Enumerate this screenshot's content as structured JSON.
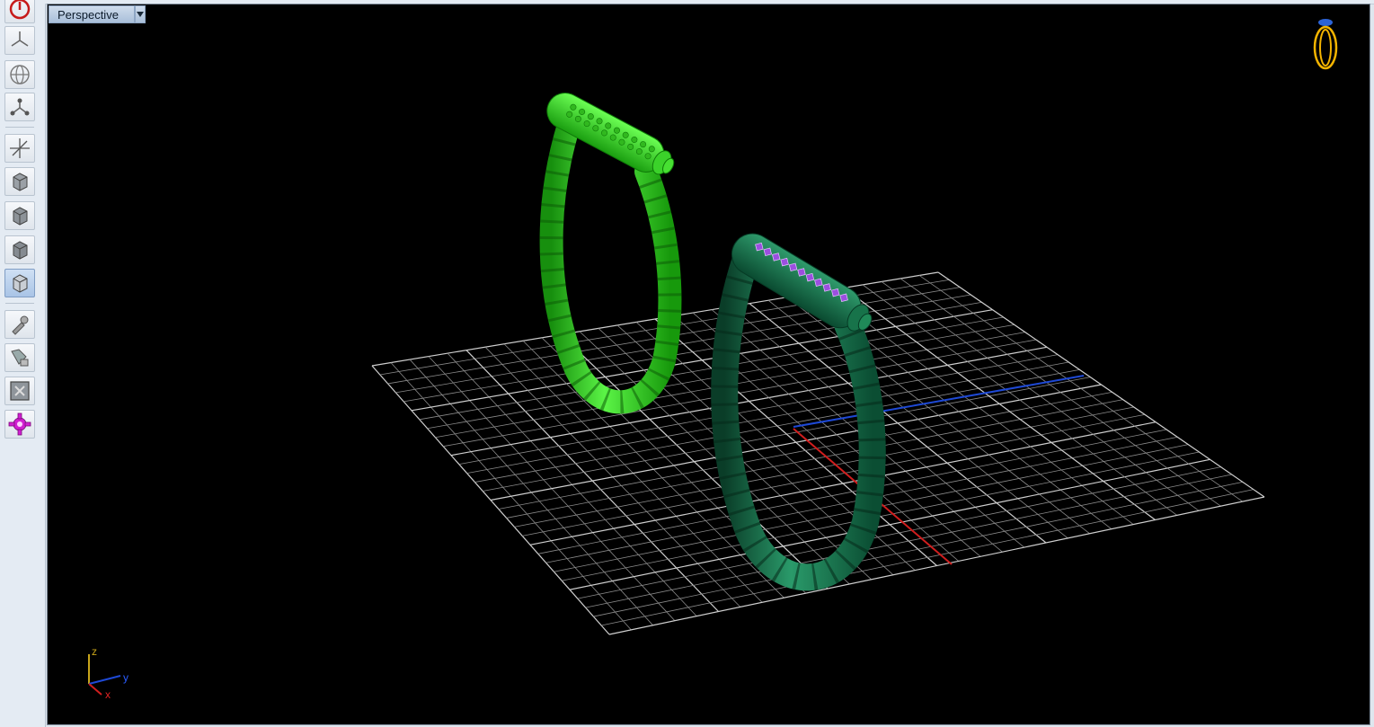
{
  "viewport": {
    "label": "Perspective",
    "dropdown_icon": "chevron-down-icon",
    "background": "#000000"
  },
  "toolbar": {
    "buttons": [
      {
        "name": "power-icon",
        "active": false
      },
      {
        "name": "top-view-icon",
        "active": false
      },
      {
        "name": "globe-icon",
        "active": false
      },
      {
        "name": "nodes-icon",
        "active": false
      },
      {
        "name": "axis-move-icon",
        "active": false
      },
      {
        "name": "cube-front-icon",
        "active": false
      },
      {
        "name": "cube-side-icon",
        "active": false
      },
      {
        "name": "cube-back-icon",
        "active": false
      },
      {
        "name": "cube-iso-icon",
        "active": true
      },
      {
        "name": "eyedropper-icon",
        "active": false
      },
      {
        "name": "paint-icon",
        "active": false
      },
      {
        "name": "fit-view-icon",
        "active": false
      },
      {
        "name": "gear-icon",
        "active": false
      }
    ]
  },
  "axes": {
    "z_label": "z",
    "y_label": "y",
    "x_label": "x",
    "colors": {
      "x": "#d01e1e",
      "y": "#1e49d6",
      "z": "#c8a51a"
    }
  },
  "objects": [
    {
      "name": "ring-handle-bright-green",
      "color": "#2bd61a"
    },
    {
      "name": "ring-handle-dark-green",
      "color": "#0f6b45",
      "gem_color": "#9b4fe0"
    }
  ],
  "corner_icon": "ring-logo-icon"
}
